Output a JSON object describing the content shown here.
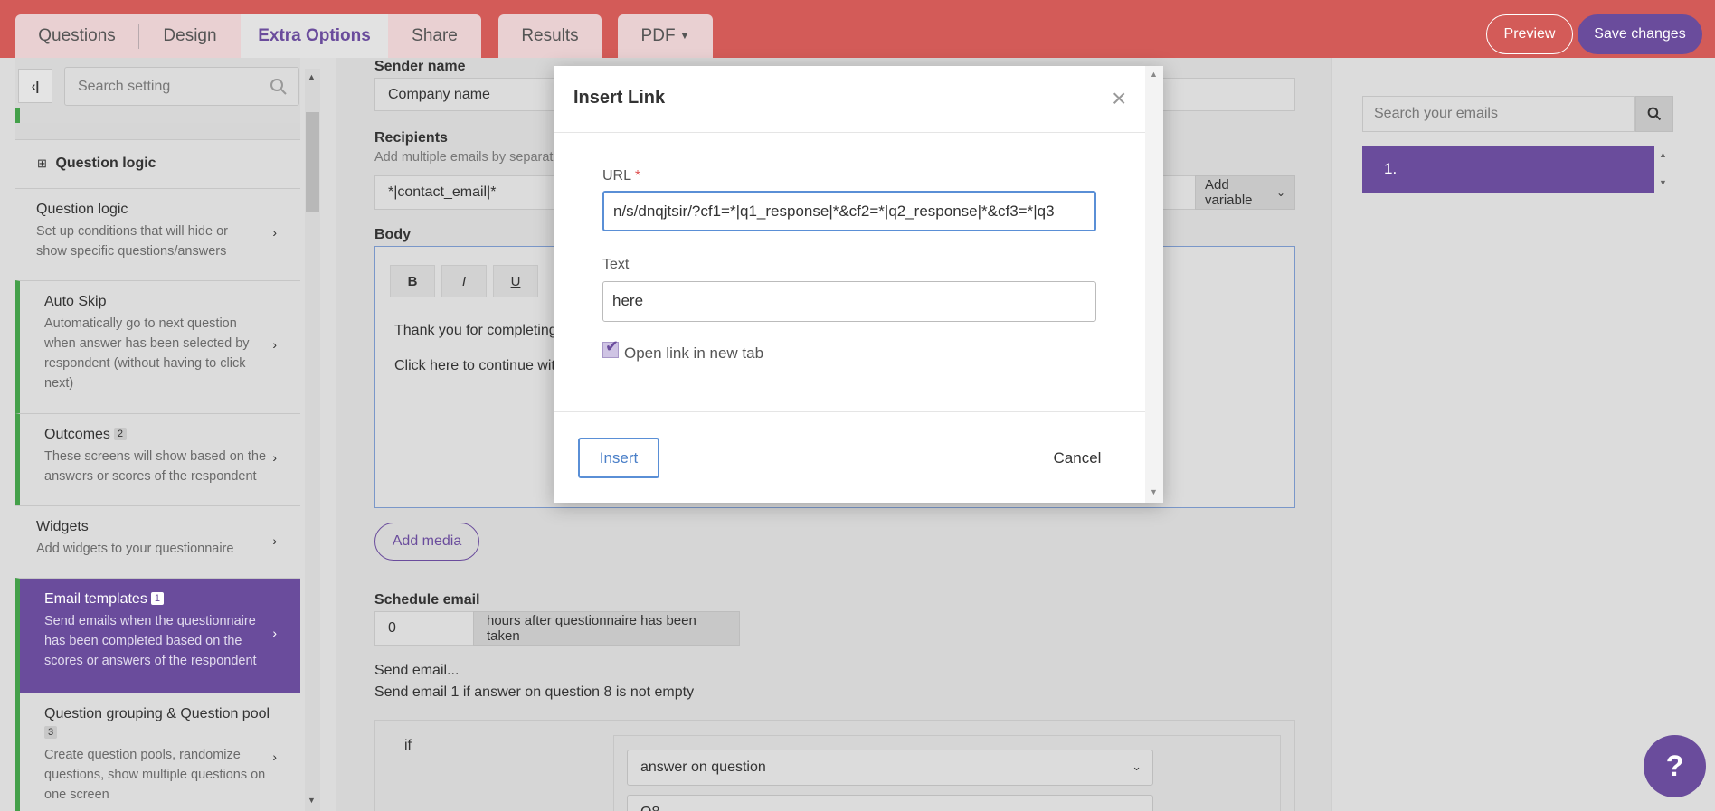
{
  "tabs": {
    "questions": "Questions",
    "design": "Design",
    "extra_options": "Extra Options",
    "share": "Share",
    "results": "Results",
    "pdf": "PDF"
  },
  "header_buttons": {
    "preview": "Preview",
    "save": "Save changes"
  },
  "sidebar": {
    "search_placeholder": "Search setting",
    "section_title": "Question logic",
    "items": [
      {
        "title": "Question logic",
        "desc": "Set up conditions that will hide or show specific questions/answers"
      },
      {
        "title": "Auto Skip",
        "desc": "Automatically go to next question when answer has been selected by respondent (without having to click next)"
      },
      {
        "title": "Outcomes",
        "badge": "2",
        "desc": "These screens will show based on the answers or scores of the respondent"
      },
      {
        "title": "Widgets",
        "desc": "Add widgets to your questionnaire"
      },
      {
        "title": "Email templates",
        "badge": "1",
        "desc": "Send emails when the questionnaire has been completed based on the scores or answers of the respondent"
      },
      {
        "title": "Question grouping & Question pool",
        "badge": "3",
        "desc": "Create question pools, randomize questions, show multiple questions on one screen"
      }
    ]
  },
  "main": {
    "sender_label": "Sender name",
    "sender_value": "Company name",
    "recipients_label": "Recipients",
    "recipients_hint": "Add multiple emails by separat",
    "recipients_value": "*|contact_email|*",
    "add_variable": "Add variable",
    "body_label": "Body",
    "format": {
      "bold": "B",
      "italic": "I",
      "underline": "U"
    },
    "body_line1": "Thank you for completing",
    "body_line2": "Click here to continue wit",
    "add_media": "Add media",
    "schedule_label": "Schedule email",
    "schedule_value": "0",
    "schedule_addon": "hours after questionnaire has been taken",
    "send_email": "Send email...",
    "send_email_rule": "Send email 1 if answer on question 8 is not empty",
    "if_label": "if",
    "condition_select": "answer on question",
    "question_select": "Q8"
  },
  "right_panel": {
    "search_placeholder": "Search your emails",
    "email_item": "1."
  },
  "modal": {
    "title": "Insert Link",
    "url_label": "URL",
    "required_mark": "*",
    "url_value": "n/s/dnqjtsir/?cf1=*|q1_response|*&cf2=*|q2_response|*&cf3=*|q3",
    "text_label": "Text",
    "text_value": "here",
    "checkbox_label": "Open link in new tab",
    "checkbox_checked": true,
    "insert": "Insert",
    "cancel": "Cancel"
  },
  "help": "?",
  "colors": {
    "topbar": "#d35b58",
    "accent": "#6a4c9c",
    "green": "#44a04a",
    "link_blue": "#5a8fd6"
  }
}
